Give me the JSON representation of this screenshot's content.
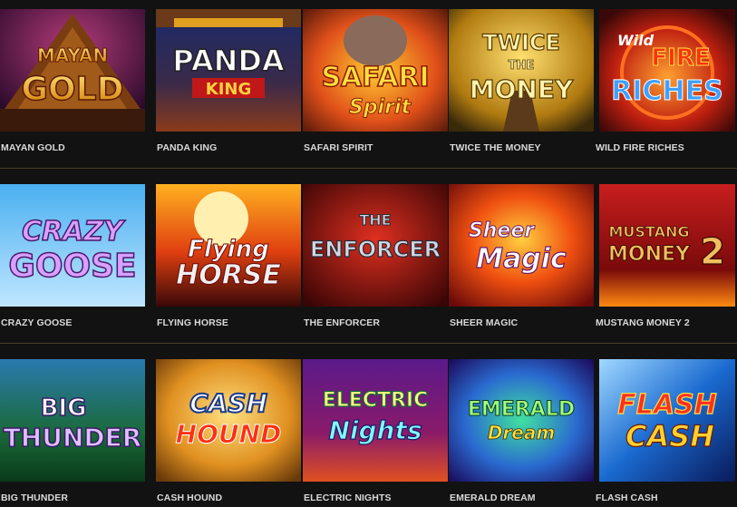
{
  "games": [
    {
      "id": "mayan-gold",
      "title": "MAYAN GOLD",
      "art": [
        "MAYAN",
        "GOLD"
      ]
    },
    {
      "id": "panda-king",
      "title": "PANDA KING",
      "art": [
        "PANDA",
        "KING"
      ]
    },
    {
      "id": "safari-spirit",
      "title": "SAFARI SPIRIT",
      "art": [
        "SAFARI",
        "Spirit"
      ]
    },
    {
      "id": "twice-the-money",
      "title": "TWICE THE MONEY",
      "art": [
        "TWICE",
        "THE",
        "MONEY"
      ]
    },
    {
      "id": "wild-fire-riches",
      "title": "WILD FIRE RICHES",
      "art": [
        "Wild",
        "FIRE",
        "RICHES"
      ]
    },
    {
      "id": "crazy-goose",
      "title": "CRAZY GOOSE",
      "art": [
        "CRAZY",
        "GOOSE"
      ]
    },
    {
      "id": "flying-horse",
      "title": "FLYING HORSE",
      "art": [
        "Flying",
        "HORSE"
      ]
    },
    {
      "id": "the-enforcer",
      "title": "THE ENFORCER",
      "art": [
        "THE",
        "ENFORCER"
      ]
    },
    {
      "id": "sheer-magic",
      "title": "SHEER MAGIC",
      "art": [
        "Sheer",
        "Magic"
      ]
    },
    {
      "id": "mustang-money-2",
      "title": "MUSTANG MONEY 2",
      "art": [
        "MUSTANG",
        "MONEY",
        "2"
      ]
    },
    {
      "id": "big-thunder",
      "title": "BIG THUNDER",
      "art": [
        "BIG",
        "THUNDER"
      ]
    },
    {
      "id": "cash-hound",
      "title": "CASH HOUND",
      "art": [
        "CASH",
        "HOUND"
      ]
    },
    {
      "id": "electric-nights",
      "title": "ELECTRIC NIGHTS",
      "art": [
        "ELECTRIC",
        "Nights"
      ]
    },
    {
      "id": "emerald-dream",
      "title": "EMERALD DREAM",
      "art": [
        "EMERALD",
        "Dream"
      ]
    },
    {
      "id": "flash-cash",
      "title": "FLASH CASH",
      "art": [
        "FLASH",
        "CASH"
      ]
    }
  ],
  "colors": {
    "background": "#121212",
    "label": "#d9d9d9",
    "separator": "#4a3f25"
  }
}
